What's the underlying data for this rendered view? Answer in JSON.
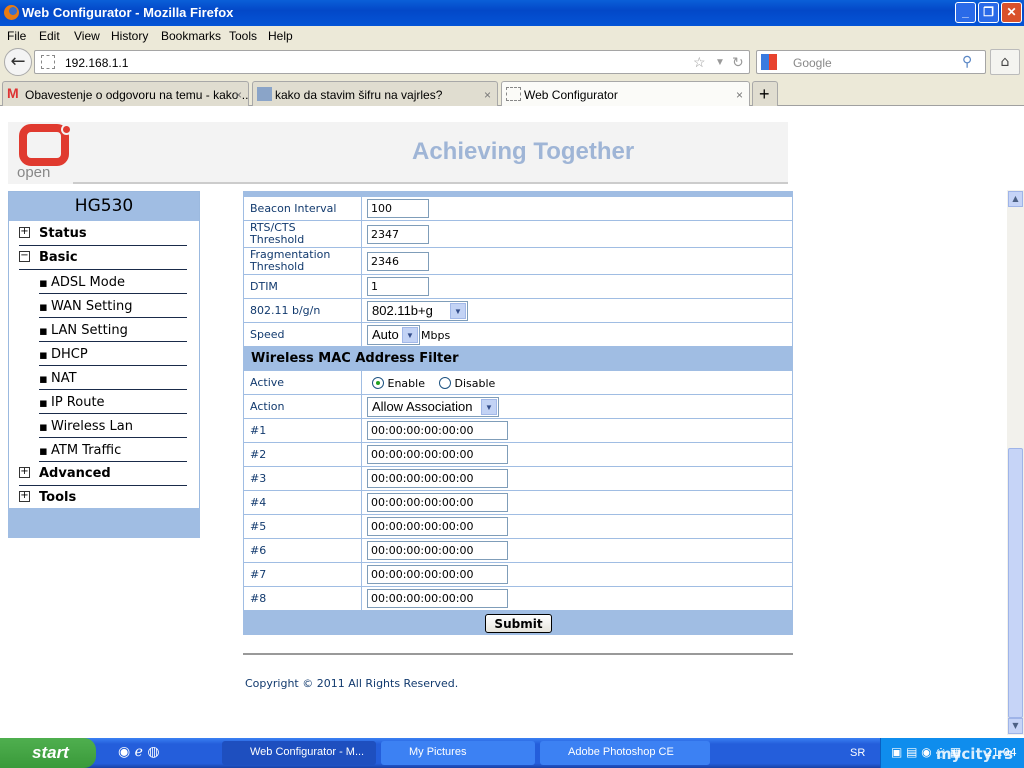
{
  "window": {
    "title": "Web Configurator - Mozilla Firefox"
  },
  "menu": [
    "File",
    "Edit",
    "View",
    "History",
    "Bookmarks",
    "Tools",
    "Help"
  ],
  "address": {
    "url": "192.168.1.1"
  },
  "search": {
    "placeholder": "Google"
  },
  "tabs": [
    {
      "label": "Obavestenje o odgovoru na temu - kako ...",
      "active": false
    },
    {
      "label": "kako da stavim šifru na vajrles?",
      "active": false
    },
    {
      "label": "Web Configurator",
      "active": true
    }
  ],
  "header": {
    "logo_text": "open",
    "slogan": "Achieving Together"
  },
  "sidebar": {
    "title": "HG530",
    "sections": [
      {
        "label": "Status",
        "sign": "+"
      },
      {
        "label": "Basic",
        "sign": "−"
      },
      {
        "label": "Advanced",
        "sign": "+"
      },
      {
        "label": "Tools",
        "sign": "+"
      }
    ],
    "basic_items": [
      "ADSL Mode",
      "WAN Setting",
      "LAN Setting",
      "DHCP",
      "NAT",
      "IP Route",
      "Wireless Lan",
      "ATM Traffic"
    ]
  },
  "wireless": {
    "beacon_label": "Beacon Interval",
    "beacon": "100",
    "rts_label": "RTS/CTS Threshold",
    "rts": "2347",
    "frag_label": "Fragmentation Threshold",
    "frag": "2346",
    "dtim_label": "DTIM",
    "dtim": "1",
    "mode_label": "802.11 b/g/n",
    "mode": "802.11b+g",
    "speed_label": "Speed",
    "speed": "Auto",
    "speed_unit": "Mbps"
  },
  "mac_filter": {
    "title": "Wireless MAC Address Filter",
    "active_label": "Active",
    "enable": "Enable",
    "disable": "Disable",
    "active_value": "Enable",
    "action_label": "Action",
    "action": "Allow Association",
    "entries": [
      {
        "label": "#1",
        "value": "00:00:00:00:00:00"
      },
      {
        "label": "#2",
        "value": "00:00:00:00:00:00"
      },
      {
        "label": "#3",
        "value": "00:00:00:00:00:00"
      },
      {
        "label": "#4",
        "value": "00:00:00:00:00:00"
      },
      {
        "label": "#5",
        "value": "00:00:00:00:00:00"
      },
      {
        "label": "#6",
        "value": "00:00:00:00:00:00"
      },
      {
        "label": "#7",
        "value": "00:00:00:00:00:00"
      },
      {
        "label": "#8",
        "value": "00:00:00:00:00:00"
      }
    ],
    "submit": "Submit"
  },
  "footer": {
    "copyright": "Copyright © 2011 All Rights Reserved."
  },
  "taskbar": {
    "start": "start",
    "tasks": [
      "Web Configurator - M...",
      "My Pictures",
      "Adobe Photoshop CE"
    ],
    "lang": "SR",
    "clock": "21:04",
    "watermark": "mycity.rs"
  }
}
